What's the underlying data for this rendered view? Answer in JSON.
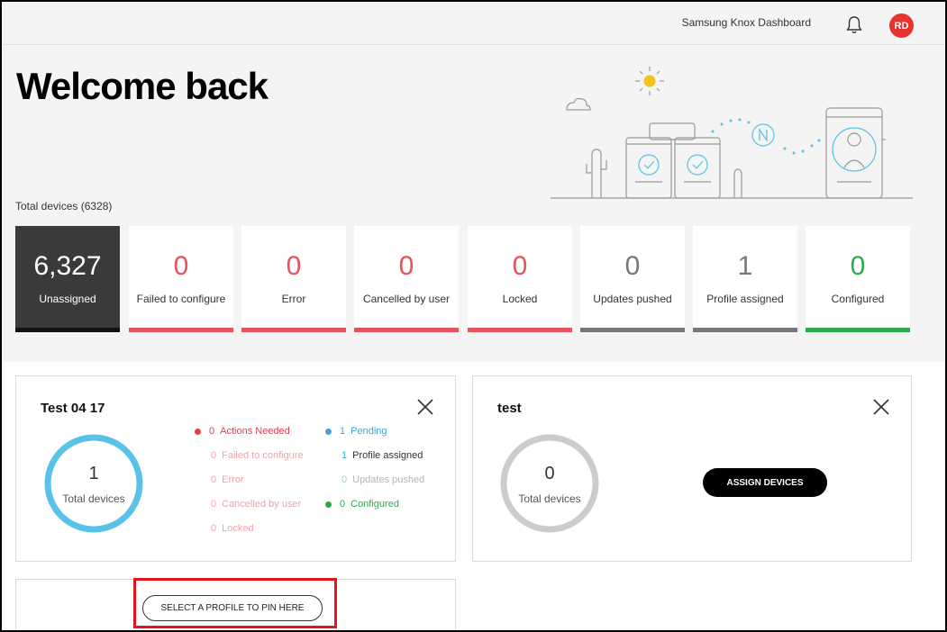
{
  "header": {
    "app_title": "Samsung Knox Dashboard",
    "avatar_initials": "RD"
  },
  "hero": {
    "welcome": "Welcome back",
    "total_devices": "Total devices (6328)"
  },
  "tiles": [
    {
      "value": "6,327",
      "label": "Unassigned",
      "color": "#111111",
      "dark": true
    },
    {
      "value": "0",
      "label": "Failed to configure",
      "color": "#e5535b"
    },
    {
      "value": "0",
      "label": "Error",
      "color": "#e5535b"
    },
    {
      "value": "0",
      "label": "Cancelled by user",
      "color": "#e5535b"
    },
    {
      "value": "0",
      "label": "Locked",
      "color": "#e5535b"
    },
    {
      "value": "0",
      "label": "Updates pushed",
      "color": "#777777"
    },
    {
      "value": "1",
      "label": "Profile assigned",
      "color": "#777777"
    },
    {
      "value": "0",
      "label": "Configured",
      "color": "#2ea94c"
    }
  ],
  "cards": {
    "test0417": {
      "title": "Test 04 17",
      "total": "1",
      "total_label": "Total devices",
      "ring_color": "#58c2e8",
      "left_list": [
        {
          "num": "0",
          "label": "Actions Needed",
          "color": "#e0414f",
          "dot": true
        },
        {
          "num": "0",
          "label": "Failed to configure",
          "color": "#f0a4aa"
        },
        {
          "num": "0",
          "label": "Error",
          "color": "#f0a4aa"
        },
        {
          "num": "0",
          "label": "Cancelled by user",
          "color": "#f0a4aa"
        },
        {
          "num": "0",
          "label": "Locked",
          "color": "#f0a4aa"
        }
      ],
      "right_list": [
        {
          "num": "1",
          "label": "Pending",
          "color": "#3aa7d8",
          "dot": true
        },
        {
          "num": "1",
          "label": "Profile assigned",
          "color": "#333333",
          "num_color": "#3aa7d8"
        },
        {
          "num": "0",
          "label": "Updates pushed",
          "color": "#b4b4b4",
          "num_color": "#8fcde8"
        },
        {
          "num": "0",
          "label": "Configured",
          "color": "#2ea94c",
          "dot": true
        }
      ]
    },
    "test": {
      "title": "test",
      "total": "0",
      "total_label": "Total devices",
      "ring_color": "#cccccc",
      "assign_label": "ASSIGN DEVICES"
    }
  },
  "pin": {
    "label": "SELECT A PROFILE TO PIN HERE"
  },
  "colors": {
    "accent_red": "#e8322d",
    "highlight": "#e3141c"
  }
}
